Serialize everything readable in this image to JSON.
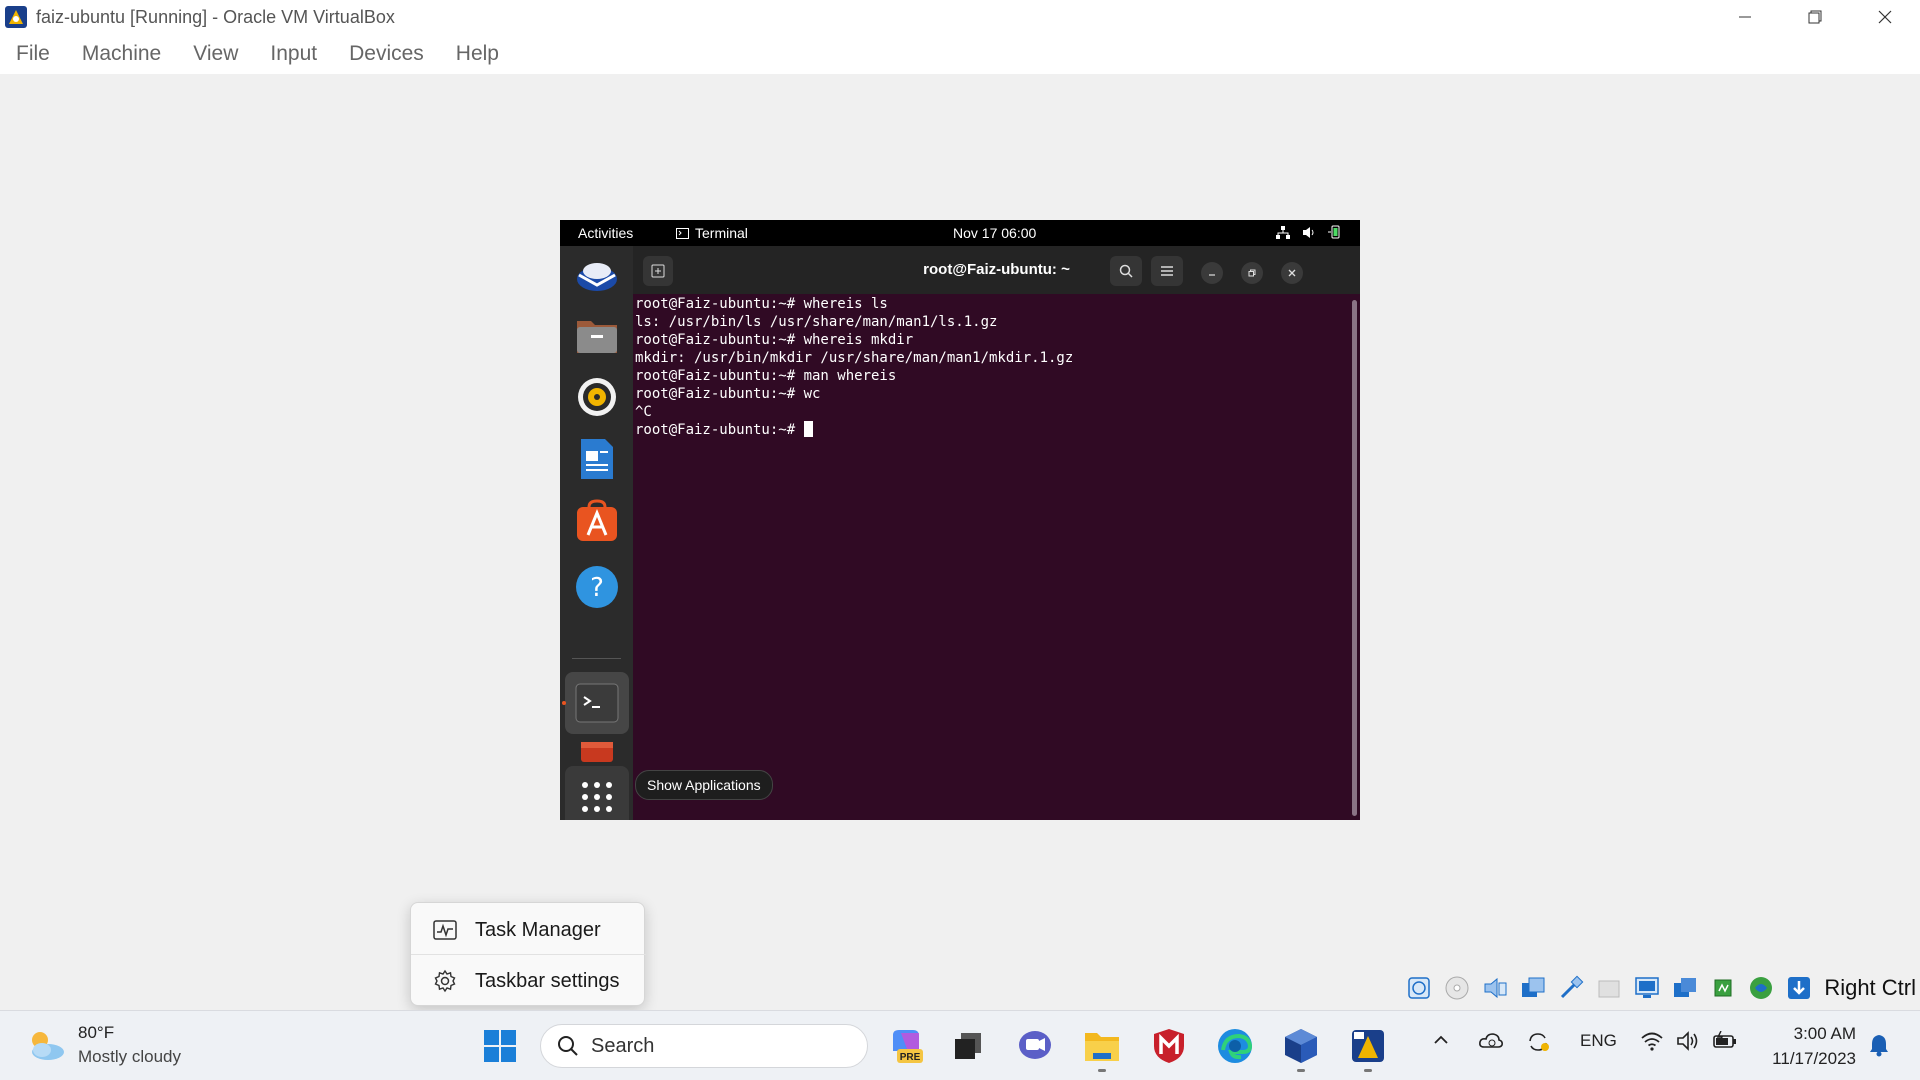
{
  "window": {
    "title": "faiz-ubuntu [Running] - Oracle VM VirtualBox",
    "controls": [
      "minimize",
      "restore",
      "close"
    ]
  },
  "menubar": [
    "File",
    "Machine",
    "View",
    "Input",
    "Devices",
    "Help"
  ],
  "guest": {
    "topbar": {
      "activities": "Activities",
      "app_name": "Terminal",
      "clock": "Nov 17  06:00"
    },
    "dock_tooltip": "Show Applications",
    "terminal": {
      "title": "root@Faiz-ubuntu: ~",
      "lines": [
        "root@Faiz-ubuntu:~# whereis ls",
        "ls: /usr/bin/ls /usr/share/man/man1/ls.1.gz",
        "root@Faiz-ubuntu:~# whereis mkdir",
        "mkdir: /usr/bin/mkdir /usr/share/man/man1/mkdir.1.gz",
        "root@Faiz-ubuntu:~# man whereis",
        "root@Faiz-ubuntu:~# wc",
        "^C"
      ],
      "prompt": "root@Faiz-ubuntu:~# "
    }
  },
  "context_menu": {
    "items": [
      "Task Manager",
      "Taskbar settings"
    ]
  },
  "vb_status": {
    "host_key": "Right Ctrl"
  },
  "taskbar": {
    "weather": {
      "temp": "80°F",
      "condition": "Mostly cloudy"
    },
    "search_placeholder": "Search",
    "pre_badge": "PRE",
    "tray": {
      "language": "ENG",
      "time": "3:00 AM",
      "date": "11/17/2023"
    }
  },
  "colors": {
    "terminal_bg": "#300a24",
    "accent": "#0078d4",
    "ubuntu_orange": "#e95420"
  }
}
